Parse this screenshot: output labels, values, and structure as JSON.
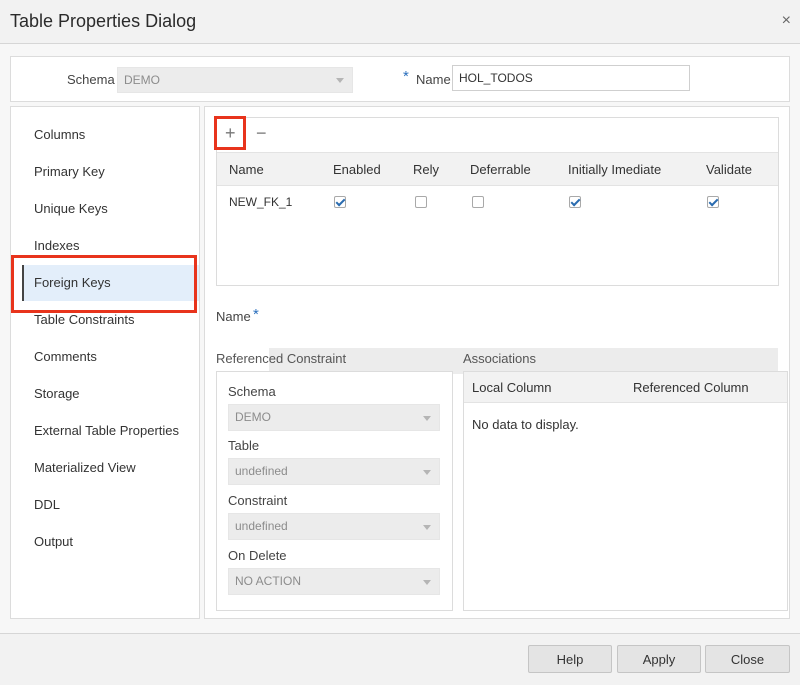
{
  "dialog": {
    "title": "Table Properties Dialog",
    "close_glyph": "×"
  },
  "header": {
    "schema_label": "Schema",
    "schema_value": "DEMO",
    "required_mark": "*",
    "name_label": "Name",
    "name_value": "HOL_TODOS"
  },
  "nav": {
    "items": [
      {
        "label": "Columns"
      },
      {
        "label": "Primary Key"
      },
      {
        "label": "Unique Keys"
      },
      {
        "label": "Indexes"
      },
      {
        "label": "Foreign Keys"
      },
      {
        "label": "Table Constraints"
      },
      {
        "label": "Comments"
      },
      {
        "label": "Storage"
      },
      {
        "label": "External Table Properties"
      },
      {
        "label": "Materialized View"
      },
      {
        "label": "DDL"
      },
      {
        "label": "Output"
      }
    ],
    "selected": "Foreign Keys"
  },
  "grid": {
    "add_glyph": "+",
    "remove_glyph": "−",
    "columns": [
      "Name",
      "Enabled",
      "Rely",
      "Deferrable",
      "Initially Imediate",
      "Validate"
    ],
    "rows": [
      {
        "name": "NEW_FK_1",
        "enabled": true,
        "rely": false,
        "deferrable": false,
        "initially_imediate": true,
        "validate": true
      }
    ]
  },
  "fk_form": {
    "name_label": "Name",
    "required_mark": "*",
    "name_value": ""
  },
  "referenced": {
    "section_label": "Referenced Constraint",
    "schema_label": "Schema",
    "schema_value": "DEMO",
    "table_label": "Table",
    "table_value": "undefined",
    "constraint_label": "Constraint",
    "constraint_value": "undefined",
    "on_delete_label": "On Delete",
    "on_delete_value": "NO ACTION"
  },
  "associations": {
    "section_label": "Associations",
    "columns": [
      "Local Column",
      "Referenced Column"
    ],
    "empty_text": "No data to display."
  },
  "footer": {
    "help_label": "Help",
    "apply_label": "Apply",
    "close_label": "Close"
  },
  "colors": {
    "highlight": "#e8341c",
    "accent": "#2a6fbd",
    "selected_bg": "#e3eefa"
  },
  "icons": {
    "close": "close-icon",
    "add": "plus-icon",
    "remove": "minus-icon",
    "check": "checkmark-icon",
    "caret": "chevron-down-icon"
  }
}
